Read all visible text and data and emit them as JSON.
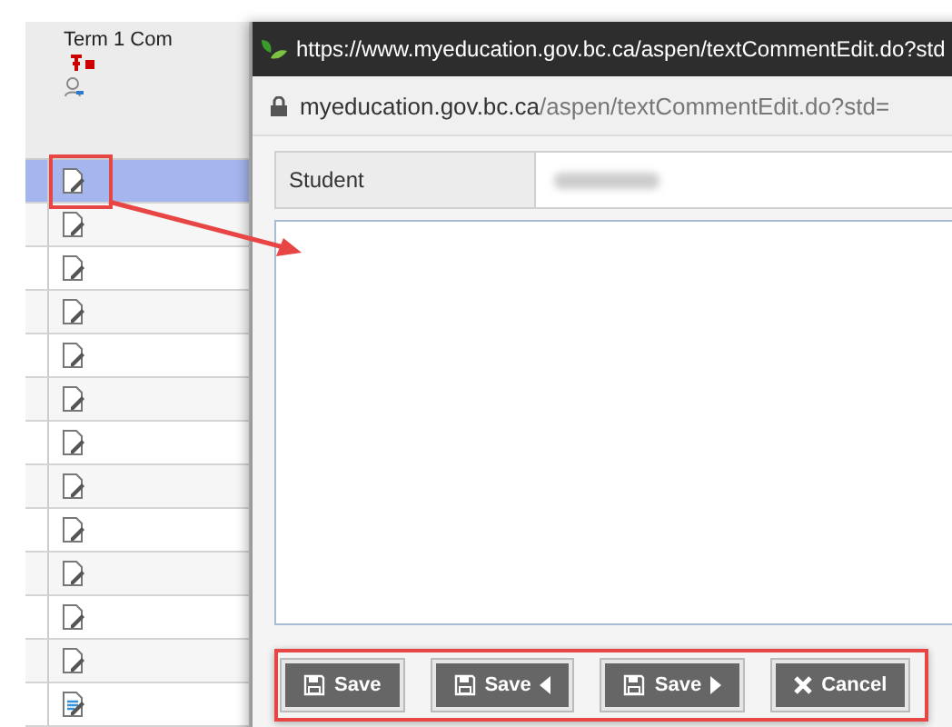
{
  "grid": {
    "column_header": "Term 1 Com",
    "rows": [
      {
        "kind": "empty",
        "selected": true
      },
      {
        "kind": "empty",
        "selected": false
      },
      {
        "kind": "empty",
        "selected": false
      },
      {
        "kind": "empty",
        "selected": false
      },
      {
        "kind": "empty",
        "selected": false
      },
      {
        "kind": "empty",
        "selected": false
      },
      {
        "kind": "empty",
        "selected": false
      },
      {
        "kind": "empty",
        "selected": false
      },
      {
        "kind": "empty",
        "selected": false
      },
      {
        "kind": "empty",
        "selected": false
      },
      {
        "kind": "empty",
        "selected": false
      },
      {
        "kind": "empty",
        "selected": false
      },
      {
        "kind": "filled",
        "selected": false
      }
    ]
  },
  "popup": {
    "title": "https://www.myeducation.gov.bc.ca/aspen/textCommentEdit.do?std",
    "address": {
      "domain": "myeducation.gov.bc.ca",
      "path": "/aspen/textCommentEdit.do?std="
    },
    "student_label": "Student",
    "buttons": [
      {
        "kind": "save",
        "label": "Save"
      },
      {
        "kind": "save-prev",
        "label": "Save"
      },
      {
        "kind": "save-next",
        "label": "Save"
      },
      {
        "kind": "cancel",
        "label": "Cancel"
      }
    ]
  }
}
